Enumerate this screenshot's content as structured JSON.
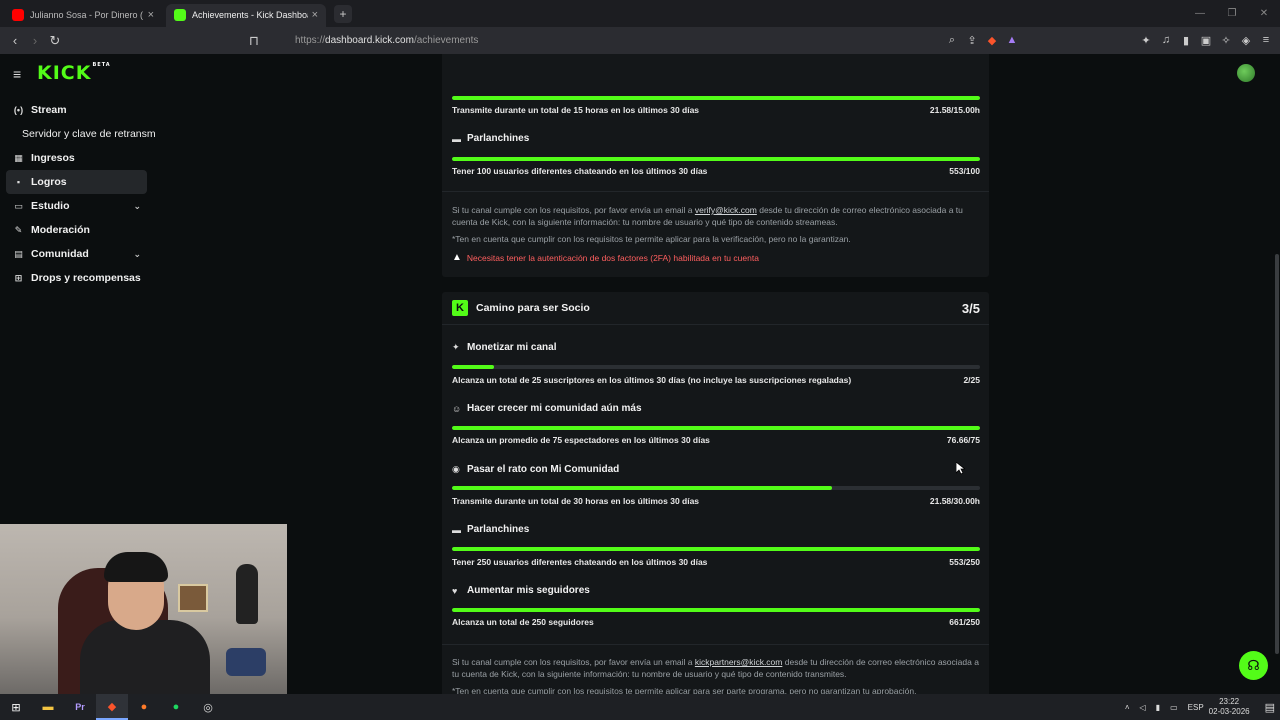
{
  "browser": {
    "tabs": [
      {
        "label": "Julianno Sosa - Por Dinero ( Offic",
        "icon": "youtube-icon",
        "color": "#ff0000"
      },
      {
        "label": "Achievements - Kick Dashboard",
        "icon": "kick-icon",
        "color": "#53fc18"
      }
    ],
    "new_tab": "+",
    "url_scheme": "https://",
    "url_host": "dashboard.kick.com",
    "url_path": "/achievements",
    "window_controls": [
      "—",
      "❐",
      "✕"
    ]
  },
  "app": {
    "logo": "KICK",
    "logo_sup": "BETA"
  },
  "sidebar": {
    "items": [
      {
        "label": "Stream",
        "icon": "broadcast-icon"
      },
      {
        "label": "Servidor y clave de retransm",
        "sub": true
      },
      {
        "label": "Ingresos",
        "icon": "money-icon"
      },
      {
        "label": "Logros",
        "icon": "trophy-icon",
        "active": true
      },
      {
        "label": "Estudio",
        "icon": "studio-icon",
        "expandable": true
      },
      {
        "label": "Moderación",
        "icon": "wrench-icon"
      },
      {
        "label": "Comunidad",
        "icon": "community-icon",
        "expandable": true
      },
      {
        "label": "Drops y recompensas",
        "icon": "gift-icon"
      }
    ]
  },
  "verification_card": {
    "partial_top": {
      "requirement": "Transmite durante un total de 15 horas en los últimos 30 días",
      "value": "21.58/15.00h",
      "progress": 1.0
    },
    "achievements": [
      {
        "title": "Parlanchines",
        "icon": "chat-icon",
        "requirement": "Tener 100 usuarios diferentes chateando en los últimos 30 días",
        "value": "553/100",
        "progress": 1.0
      }
    ],
    "note_line1_pre": "Si tu canal cumple con los requisitos, por favor envía un email a ",
    "note_link": "verify@kick.com",
    "note_line1_post": " desde tu dirección de correo electrónico asociada a tu cuenta de Kick, con la siguiente información: tu nombre de usuario y qué tipo de contenido streameas.",
    "note_line2": "*Ten en cuenta que cumplir con los requisitos te permite aplicar para la verificación, pero no la garantizan.",
    "warning": "Necesitas tener la autenticación de dos factores (2FA) habilitada en tu cuenta"
  },
  "partner_card": {
    "title": "Camino para ser Socio",
    "count": "3/5",
    "achievements": [
      {
        "title": "Monetizar mi canal",
        "icon": "sparkle-icon",
        "requirement": "Alcanza un total de 25 suscriptores en los últimos 30 días (no incluye las suscripciones regaladas)",
        "value": "2/25",
        "progress": 0.08
      },
      {
        "title": "Hacer crecer mi comunidad aún más",
        "icon": "users-icon",
        "requirement": "Alcanza un promedio de 75 espectadores en los últimos 30 días",
        "value": "76.66/75",
        "progress": 1.0
      },
      {
        "title": "Pasar el rato con Mi Comunidad",
        "icon": "broadcast-icon",
        "requirement": "Transmite durante un total de 30 horas en los últimos 30 días",
        "value": "21.58/30.00h",
        "progress": 0.72
      },
      {
        "title": "Parlanchines",
        "icon": "chat-icon",
        "requirement": "Tener 250 usuarios diferentes chateando en los últimos 30 días",
        "value": "553/250",
        "progress": 1.0
      },
      {
        "title": "Aumentar mis seguidores",
        "icon": "heart-icon",
        "requirement": "Alcanza un total de 250 seguidores",
        "value": "661/250",
        "progress": 1.0
      }
    ],
    "note_line1_pre": "Si tu canal cumple con los requisitos, por favor envía un email a ",
    "note_link": "kickpartners@kick.com",
    "note_line1_post": " desde tu dirección de correo electrónico asociada a tu cuenta de Kick, con la siguiente información: tu nombre de usuario y qué tipo de contenido transmites.",
    "note_line2": "*Ten en cuenta que cumplir con los requisitos te permite aplicar para ser parte programa, pero no garantizan tu aprobación."
  },
  "taskbar": {
    "apps": [
      "windows-icon",
      "explorer-icon",
      "premiere-icon",
      "brave-icon",
      "firefox-icon",
      "spotify-icon",
      "obs-icon"
    ],
    "lang": "ESP",
    "time": "23:22",
    "date": "02-03-2026"
  },
  "colors": {
    "accent": "#53fc18",
    "warning": "#ff5f5f",
    "background": "#0b0e0f",
    "card": "#141719"
  }
}
